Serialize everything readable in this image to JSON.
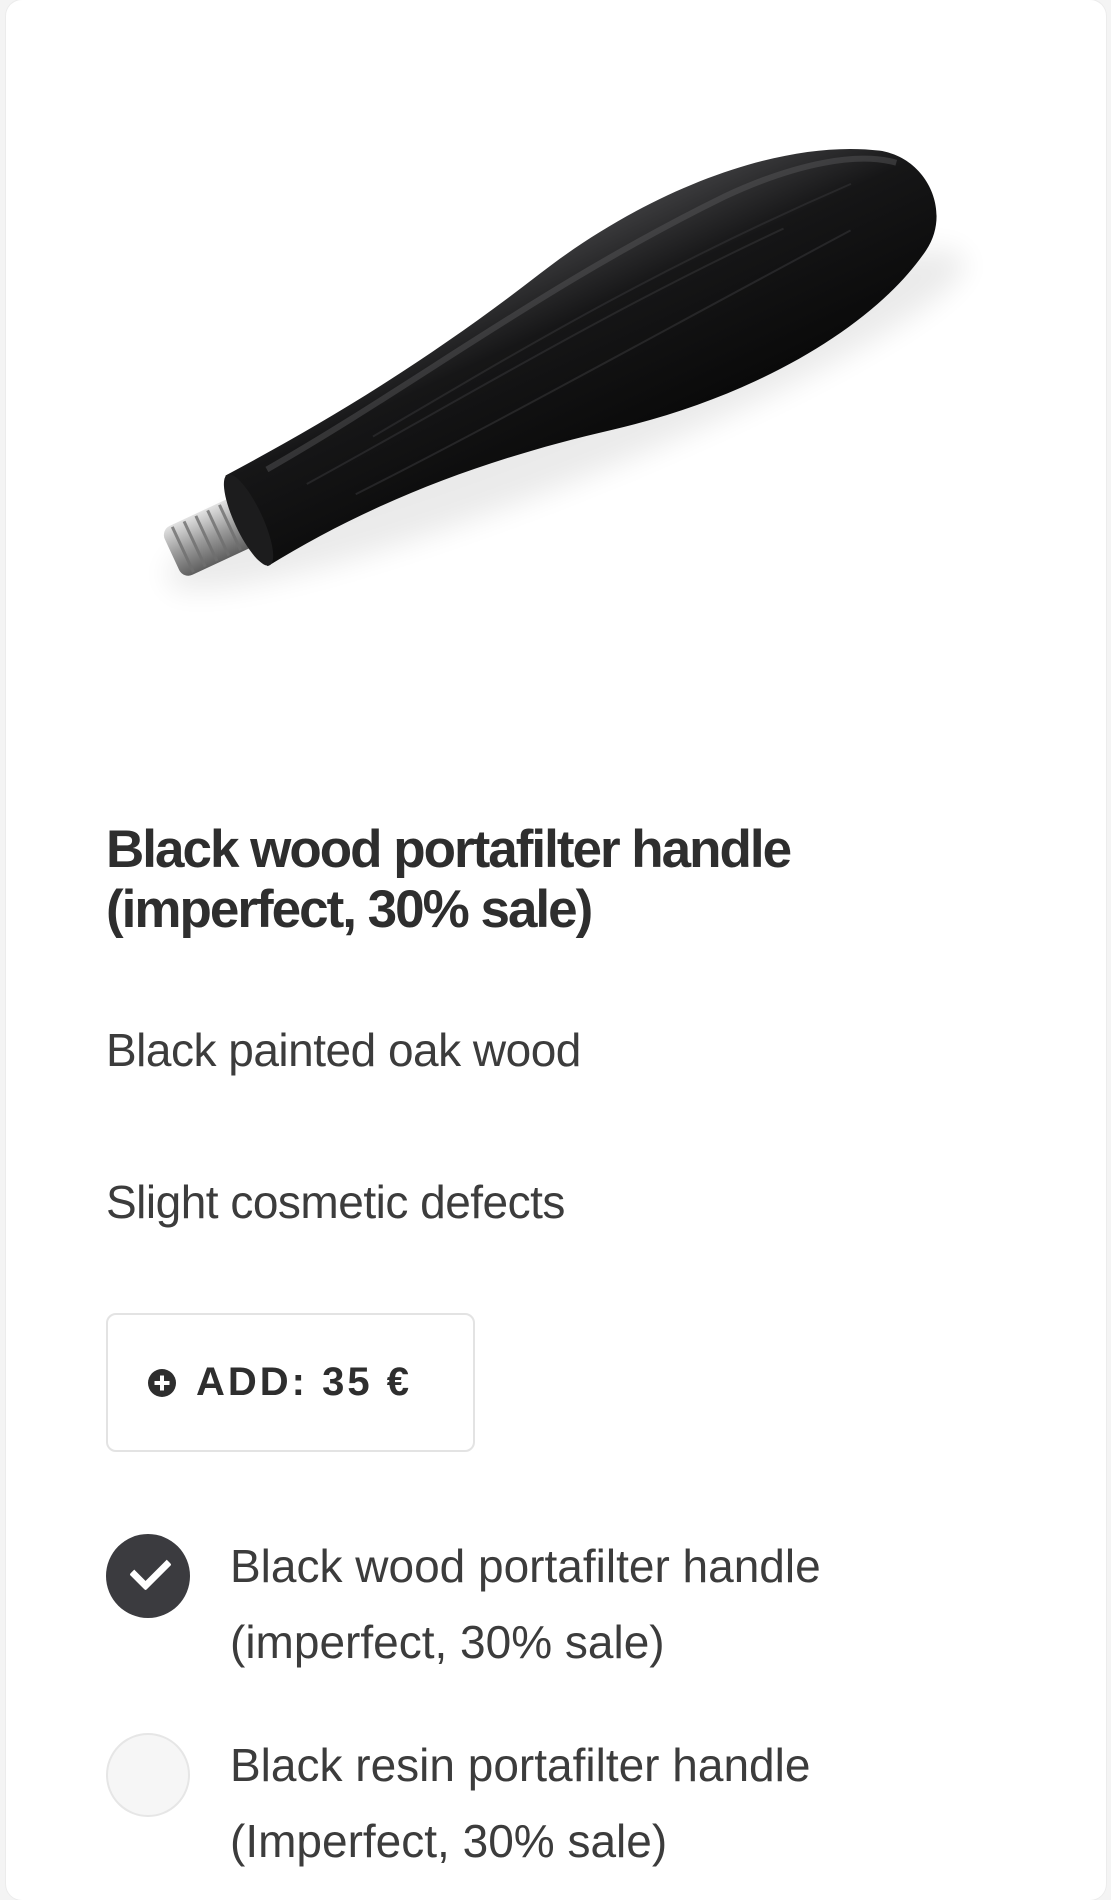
{
  "product": {
    "title": "Black wood portafilter handle (imperfect, 30% sale)",
    "description_lines": [
      "Black painted oak wood",
      "Slight cosmetic defects"
    ],
    "image_icon": "portafilter-handle-photo"
  },
  "add_button": {
    "label": "ADD: 35 €",
    "icon": "plus-circle-icon"
  },
  "options": [
    {
      "label": "Black wood portafilter handle (imperfect, 30% sale)",
      "selected": true
    },
    {
      "label": "Black resin portafilter handle (Imperfect, 30% sale)",
      "selected": false
    }
  ],
  "colors": {
    "accent": "#3b3b3f",
    "text": "#333333",
    "border": "#e3e3e3"
  }
}
